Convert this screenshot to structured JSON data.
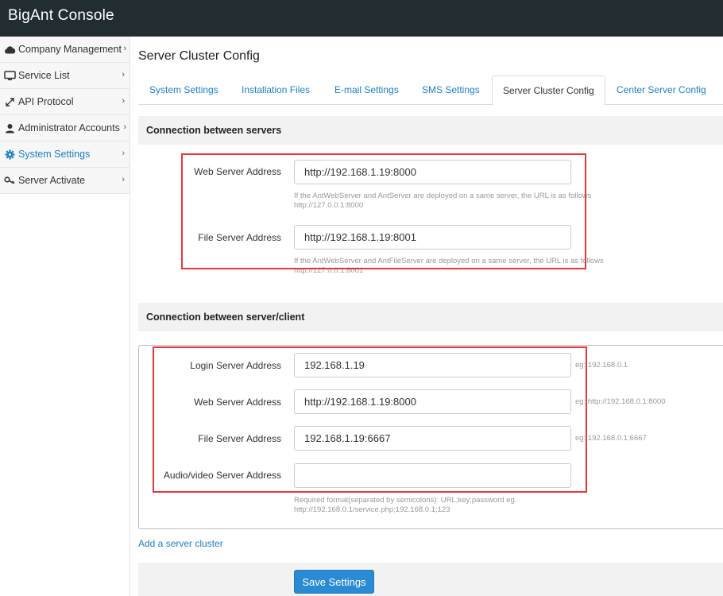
{
  "app": {
    "title": "BigAnt Console"
  },
  "sidebar": {
    "items": [
      {
        "label": "Company Management",
        "icon": "cloud-icon"
      },
      {
        "label": "Service List",
        "icon": "monitor-icon"
      },
      {
        "label": "API Protocol",
        "icon": "expand-arrows-icon"
      },
      {
        "label": "Administrator Accounts",
        "icon": "user-icon"
      },
      {
        "label": "System Settings",
        "icon": "gear-icon",
        "active": true
      },
      {
        "label": "Server Activate",
        "icon": "key-icon"
      }
    ],
    "chevron": "›"
  },
  "page": {
    "title": "Server Cluster Config"
  },
  "tabs": [
    {
      "label": "System Settings"
    },
    {
      "label": "Installation Files"
    },
    {
      "label": "E-mail Settings"
    },
    {
      "label": "SMS Settings"
    },
    {
      "label": "Server Cluster Config",
      "active": true
    },
    {
      "label": "Center Server Config"
    }
  ],
  "server_section": {
    "title": "Connection between servers",
    "web": {
      "label": "Web Server Address",
      "value": "http://192.168.1.19:8000",
      "help_line1": "If the AntWebServer and AntServer are deployed on a same server, the URL is as follows",
      "help_line2": "http://127.0.0.1:8000"
    },
    "file": {
      "label": "File Server Address",
      "value": "http://192.168.1.19:8001",
      "help_line1": "If the AntWebServer and AntFileServer are deployed on a same server, the URL is as follows",
      "help_line2": "http://127.0.0.1:8001"
    }
  },
  "client_section": {
    "title": "Connection between server/client",
    "login": {
      "label": "Login Server Address",
      "value": "192.168.1.19",
      "hint": "eg: 192.168.0.1"
    },
    "web": {
      "label": "Web Server Address",
      "value": "http://192.168.1.19:8000",
      "hint": "eg: http://192.168.0.1:8000"
    },
    "file": {
      "label": "File Server Address",
      "value": "192.168.1.19:6667",
      "hint": "eg: 192.168.0.1:6667"
    },
    "av": {
      "label": "Audio/video Server Address",
      "value": "",
      "help_line1": "Required format(separated by semicolons): URL;key;password eg.",
      "help_line2": "http://192.168.0.1/service.php;192.168.0.1;123"
    }
  },
  "actions": {
    "add_cluster": "Add a server cluster",
    "save": "Save Settings"
  },
  "colors": {
    "topbar": "#222d32",
    "link": "#1d7fc9",
    "highlight_box": "#e5383b",
    "save_button": "#2a8ad4"
  }
}
